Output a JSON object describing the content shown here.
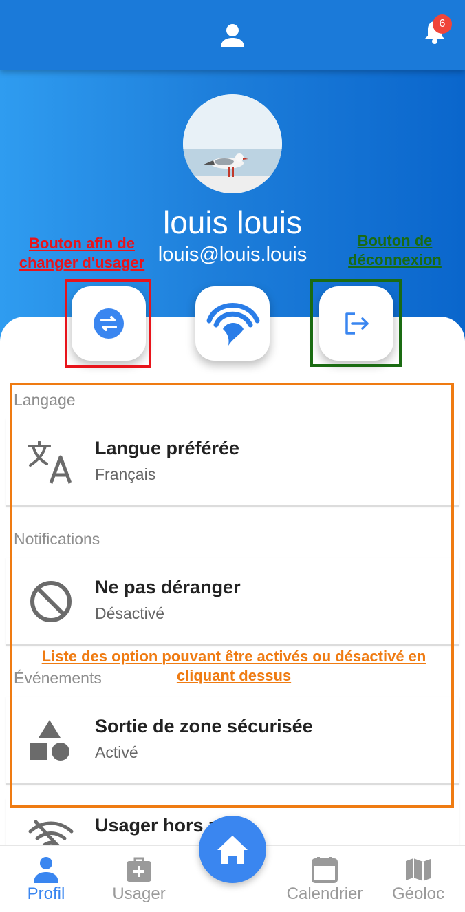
{
  "header": {
    "notification_count": "6"
  },
  "profile": {
    "name": "louis louis",
    "email": "louis@louis.louis"
  },
  "annotations": {
    "switch_user": "Bouton afin de changer d'usager",
    "logout": "Bouton de déconnexion",
    "options_list": "Liste des option pouvant être activés ou désactivé en cliquant dessus"
  },
  "sections": [
    {
      "title": "Langage",
      "item": {
        "title": "Langue préférée",
        "value": "Français"
      }
    },
    {
      "title": "Notifications",
      "item": {
        "title": "Ne pas déranger",
        "value": "Désactivé"
      }
    },
    {
      "title": "Événements",
      "item": {
        "title": "Sortie de zone sécurisée",
        "value": "Activé"
      }
    },
    {
      "item": {
        "title": "Usager hors zone"
      }
    }
  ],
  "nav": {
    "items": [
      {
        "label": "Profil",
        "active": true
      },
      {
        "label": "Usager"
      },
      {
        "label": "Calendrier"
      },
      {
        "label": "Géoloc"
      }
    ]
  },
  "colors": {
    "accent": "#3a86f0",
    "header": "#1b7ad9",
    "annotation_red": "#e8141b",
    "annotation_green": "#1a6b12",
    "annotation_orange": "#ef7b12"
  }
}
